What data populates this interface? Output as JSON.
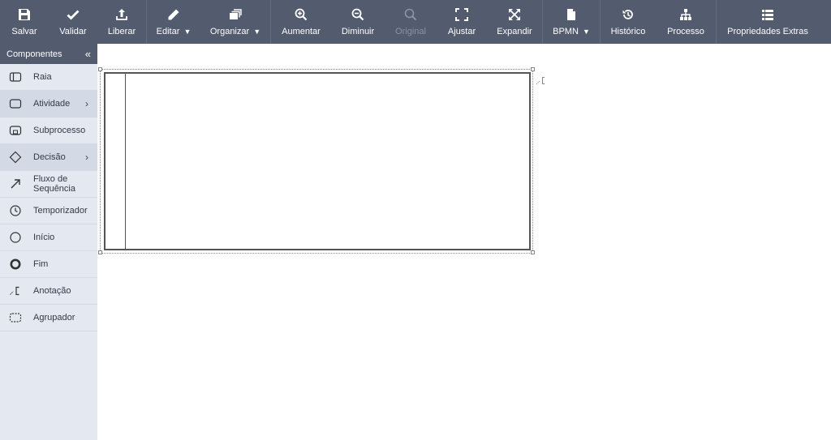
{
  "toolbar": {
    "salvar": "Salvar",
    "validar": "Validar",
    "liberar": "Liberar",
    "editar": "Editar",
    "organizar": "Organizar",
    "aumentar": "Aumentar",
    "diminuir": "Diminuir",
    "original": "Original",
    "ajustar": "Ajustar",
    "expandir": "Expandir",
    "bpmn": "BPMN",
    "historico": "Histórico",
    "processo": "Processo",
    "propriedades": "Propriedades Extras",
    "caret": "▼"
  },
  "sidebar": {
    "title": "Componentes",
    "collapse": "«",
    "items": [
      {
        "label": "Raia",
        "icon": "lane-icon"
      },
      {
        "label": "Atividade",
        "icon": "activity-icon",
        "arrow": "›"
      },
      {
        "label": "Subprocesso",
        "icon": "subprocess-icon"
      },
      {
        "label": "Decisão",
        "icon": "gateway-icon",
        "arrow": "›"
      },
      {
        "label": "Fluxo de Sequência",
        "icon": "arrow-icon"
      },
      {
        "label": "Temporizador",
        "icon": "clock-icon"
      },
      {
        "label": "Início",
        "icon": "start-event-icon"
      },
      {
        "label": "Fim",
        "icon": "end-event-icon"
      },
      {
        "label": "Anotação",
        "icon": "annotation-icon"
      },
      {
        "label": "Agrupador",
        "icon": "group-icon"
      }
    ]
  },
  "colors": {
    "toolbar_bg": "#535b6f",
    "sidebar_bg": "#e3e8f1",
    "sidebar_active": "#d3dae6"
  }
}
